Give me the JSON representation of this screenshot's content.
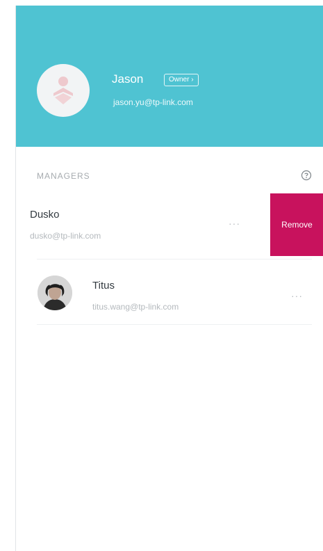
{
  "owner": {
    "name": "Jason",
    "role_label": "Owner",
    "email": "jason.yu@tp-link.com"
  },
  "managers": {
    "section_title": "MANAGERS",
    "remove_label": "Remove",
    "items": [
      {
        "name": "Dusko",
        "email": "dusko@tp-link.com",
        "more": "···"
      },
      {
        "name": "Titus",
        "email": "titus.wang@tp-link.com",
        "more": "···"
      }
    ]
  },
  "colors": {
    "header": "#4fc3d2",
    "remove": "#c8125d"
  },
  "icons": {
    "owner_avatar": "default-user-icon",
    "help": "question-circle-icon",
    "more": "more-dots-icon"
  }
}
